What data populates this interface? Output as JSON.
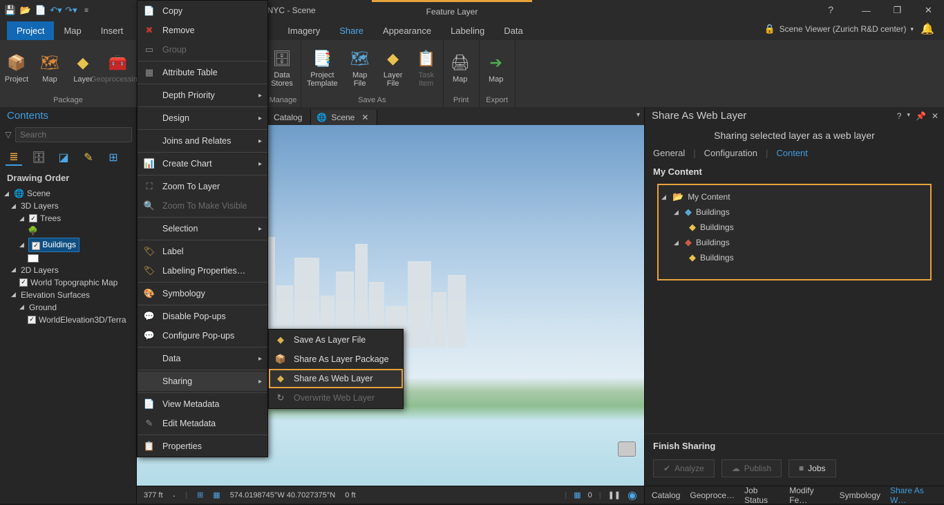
{
  "titlebar": {
    "project_suffix": "hNYC - Scene",
    "feature_layer_label": "Feature Layer"
  },
  "ribbon_tabs": {
    "project": "Project",
    "map": "Map",
    "insert": "Insert",
    "imagery": "Imagery",
    "share": "Share",
    "appearance": "Appearance",
    "labeling": "Labeling",
    "data": "Data"
  },
  "user": {
    "name": "Scene Viewer (Zurich R&D center)"
  },
  "ribbon": {
    "package_group": "Package",
    "manage_group": "Manage",
    "saveas_group": "Save As",
    "print_group": "Print",
    "export_group": "Export",
    "buttons": {
      "project": "Project",
      "map": "Map",
      "layer": "Layer",
      "geoprocessing": "Geoprocessin…",
      "data_stores": "Data\nStores",
      "project_template": "Project\nTemplate",
      "map_file": "Map\nFile",
      "layer_file": "Layer\nFile",
      "task_item": "Task\nItem",
      "print_map": "Map",
      "export_map": "Map"
    }
  },
  "contents": {
    "title": "Contents",
    "search_placeholder": "Search",
    "drawing_order": "Drawing Order",
    "scene": "Scene",
    "layers3d": "3D Layers",
    "trees": "Trees",
    "buildings": "Buildings",
    "layers2d": "2D Layers",
    "topo": "World Topographic Map",
    "elev": "Elevation Surfaces",
    "ground": "Ground",
    "worldelev": "WorldElevation3D/Terra"
  },
  "doc_tabs": {
    "catalog": "Catalog",
    "scene": "Scene"
  },
  "map_status": {
    "scale": "377 ft",
    "coords": "574.0198745°W 40.7027375°N",
    "elev": "0 ft",
    "sel": "0"
  },
  "ctx": {
    "copy": "Copy",
    "remove": "Remove",
    "group": "Group",
    "attr_table": "Attribute Table",
    "depth_priority": "Depth Priority",
    "design": "Design",
    "joins": "Joins and Relates",
    "create_chart": "Create Chart",
    "zoom_layer": "Zoom To Layer",
    "zoom_visible": "Zoom To Make Visible",
    "selection": "Selection",
    "label": "Label",
    "label_props": "Labeling Properties…",
    "symbology": "Symbology",
    "disable_popups": "Disable Pop-ups",
    "configure_popups": "Configure Pop-ups",
    "data": "Data",
    "sharing": "Sharing",
    "view_meta": "View Metadata",
    "edit_meta": "Edit Metadata",
    "properties": "Properties"
  },
  "submenu": {
    "save_layer_file": "Save As Layer File",
    "share_layer_pkg": "Share As Layer Package",
    "share_web_layer": "Share As Web Layer",
    "overwrite": "Overwrite Web Layer"
  },
  "share_pane": {
    "title": "Share As Web Layer",
    "subtitle": "Sharing selected layer as a web layer",
    "tab_general": "General",
    "tab_config": "Configuration",
    "tab_content": "Content",
    "my_content_head": "My Content",
    "tree": {
      "root": "My Content",
      "buildings_folder1": "Buildings",
      "buildings_layer1": "Buildings",
      "buildings_folder2": "Buildings",
      "buildings_layer2": "Buildings"
    },
    "finish": "Finish Sharing",
    "analyze": "Analyze",
    "publish": "Publish",
    "jobs": "Jobs"
  },
  "bottom_tabs": {
    "catalog": "Catalog",
    "geoproc": "Geoproce…",
    "jobstatus": "Job Status",
    "modify": "Modify Fe…",
    "symbology": "Symbology",
    "shareas": "Share As W…"
  }
}
